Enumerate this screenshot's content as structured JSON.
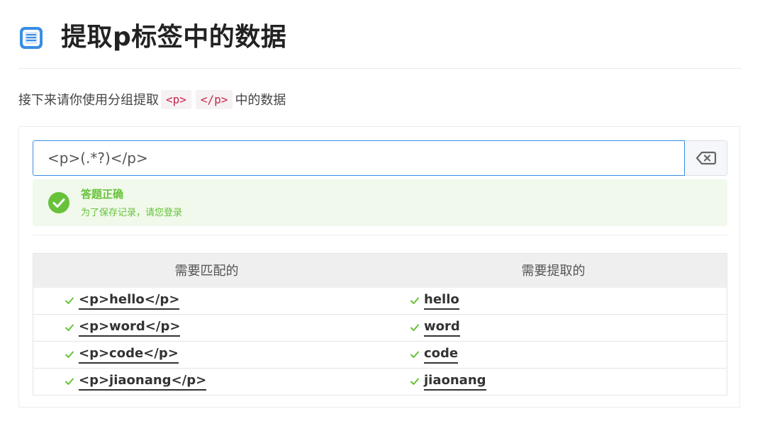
{
  "page": {
    "title": "提取p标签中的数据",
    "icon": "document-icon"
  },
  "instruction": {
    "prefix": "接下来请你使用分组提取",
    "code_open": "<p>",
    "code_close": "</p>",
    "suffix": "中的数据"
  },
  "answer": {
    "value": "<p>(.*?)</p>",
    "clear_icon": "backspace-icon"
  },
  "alert": {
    "title": "答题正确",
    "description": "为了保存记录，请您登录",
    "icon": "check-circle-icon",
    "color": "#67c23a"
  },
  "table": {
    "headers": [
      "需要匹配的",
      "需要提取的"
    ],
    "rows": [
      {
        "match": "<p>hello</p>",
        "extract": "hello"
      },
      {
        "match": "<p>word</p>",
        "extract": "word"
      },
      {
        "match": "<p>code</p>",
        "extract": "code"
      },
      {
        "match": "<p>jiaonang</p>",
        "extract": "jiaonang"
      }
    ]
  },
  "colors": {
    "accent": "#3a8ee6",
    "success": "#67c23a",
    "code": "#c7254e"
  }
}
